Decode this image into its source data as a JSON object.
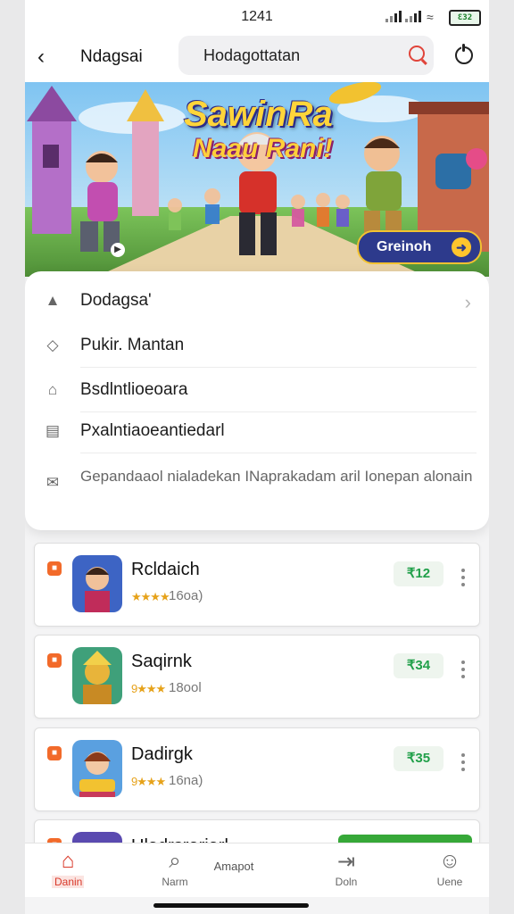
{
  "status_bar": {
    "time": "1241",
    "battery": "Ɛ32"
  },
  "header": {
    "title": "Ndagsai",
    "search_value": "Hodagottatan"
  },
  "banner": {
    "title_line1": "SawinRa",
    "title_line2": "Naau Rani!",
    "cta_label": "Greinoh"
  },
  "menu": {
    "items": [
      {
        "label": "Dodagsa'",
        "icon": "user-icon"
      },
      {
        "label": "Pukir. Mantan",
        "icon": "shield-icon"
      },
      {
        "label": "Bsdlntlioeoara",
        "icon": "home-icon"
      },
      {
        "label": "Pxalntiaoeantiedarl",
        "icon": "document-icon"
      }
    ],
    "description": "Gepandaaol nialadekan INaprakadam aril Ionepan alonain"
  },
  "apps": [
    {
      "name": "Rcldaich",
      "stars": "★★★★",
      "reviews": "16oa)",
      "price": "₹12"
    },
    {
      "name": "Saqirnk",
      "stars": "9★★★",
      "reviews": "18ool",
      "price": "₹34"
    },
    {
      "name": "Dadirgk",
      "stars": "9★★★",
      "reviews": "16na)",
      "price": "₹35"
    }
  ],
  "partial_app": {
    "name": "Uladrsrariarl"
  },
  "nav": {
    "tabs": [
      {
        "label": "Danin",
        "icon": "home-icon",
        "active": true
      },
      {
        "label": "Narm",
        "icon": "search-icon",
        "extra": "Amapot"
      },
      {
        "label": "Doln",
        "icon": "download-icon"
      },
      {
        "label": "Uene",
        "icon": "profile-icon"
      }
    ]
  },
  "colors": {
    "accent": "#d93a2b",
    "price_green": "#21a04a",
    "banner_button": "#2d3a8c"
  }
}
